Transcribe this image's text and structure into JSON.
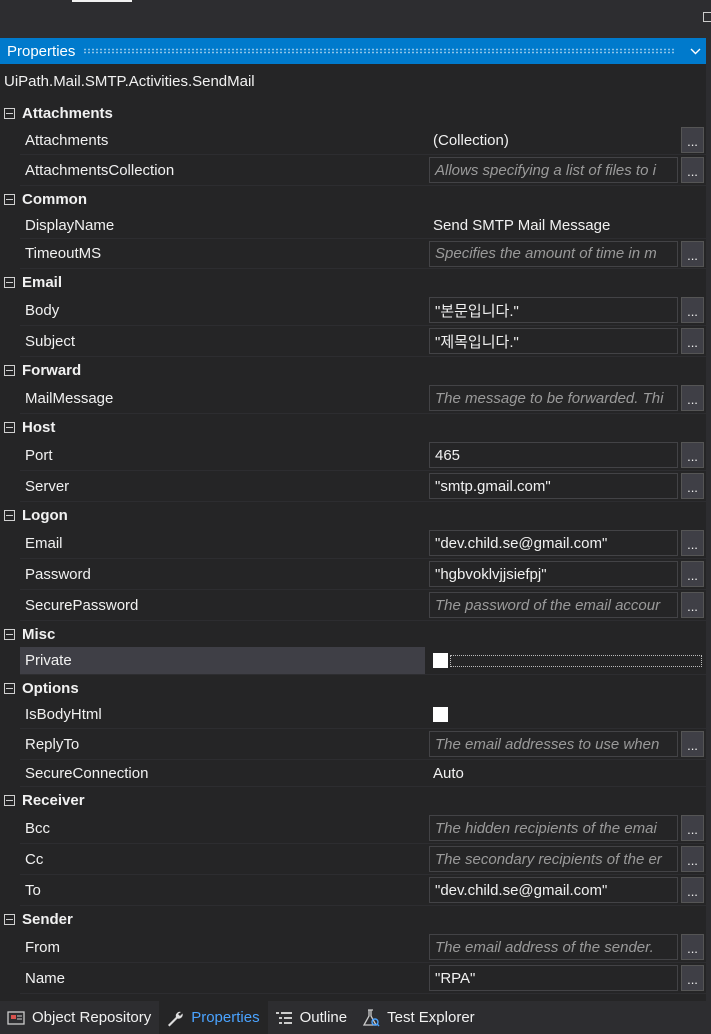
{
  "panel": {
    "title": "Properties",
    "type_name": "UiPath.Mail.SMTP.Activities.SendMail"
  },
  "categories": [
    {
      "name": "Attachments",
      "rows": [
        {
          "label": "Attachments",
          "value": "(Collection)",
          "kind": "plain",
          "ellipsis": true,
          "h": 29
        },
        {
          "label": "AttachmentsCollection",
          "value": "Allows specifying a list of files to i",
          "kind": "hint",
          "ellipsis": true,
          "h": 31
        }
      ]
    },
    {
      "name": "Common",
      "rows": [
        {
          "label": "DisplayName",
          "value": "Send SMTP Mail Message",
          "kind": "plain",
          "ellipsis": false,
          "h": 27
        },
        {
          "label": "TimeoutMS",
          "value": "Specifies the amount of time in m",
          "kind": "hint",
          "ellipsis": true,
          "h": 30
        }
      ]
    },
    {
      "name": "Email",
      "rows": [
        {
          "label": "Body",
          "value": "\"본문입니다.\"",
          "kind": "box",
          "ellipsis": true,
          "h": 31
        },
        {
          "label": "Subject",
          "value": "\"제목입니다.\"",
          "kind": "box",
          "ellipsis": true,
          "h": 31
        }
      ]
    },
    {
      "name": "Forward",
      "rows": [
        {
          "label": "MailMessage",
          "value": "The message to be forwarded. Thi",
          "kind": "hint",
          "ellipsis": true,
          "h": 31
        }
      ]
    },
    {
      "name": "Host",
      "rows": [
        {
          "label": "Port",
          "value": "465",
          "kind": "box",
          "ellipsis": true,
          "h": 31
        },
        {
          "label": "Server",
          "value": "\"smtp.gmail.com\"",
          "kind": "box",
          "ellipsis": true,
          "h": 31
        }
      ]
    },
    {
      "name": "Logon",
      "rows": [
        {
          "label": "Email",
          "value": "\"dev.child.se@gmail.com\"",
          "kind": "box",
          "ellipsis": true,
          "h": 31
        },
        {
          "label": "Password",
          "value": "\"hgbvoklvjjsiefpj\"",
          "kind": "box",
          "ellipsis": true,
          "h": 31
        },
        {
          "label": "SecurePassword",
          "value": "The password of the email accour",
          "kind": "hint",
          "ellipsis": true,
          "h": 31
        }
      ]
    },
    {
      "name": "Misc",
      "rows": [
        {
          "label": "Private",
          "value": "",
          "kind": "checkdots",
          "ellipsis": false,
          "h": 28,
          "selected": true
        }
      ]
    },
    {
      "name": "Options",
      "rows": [
        {
          "label": "IsBodyHtml",
          "value": "",
          "kind": "check",
          "ellipsis": false,
          "h": 28
        },
        {
          "label": "ReplyTo",
          "value": "The email addresses to use when",
          "kind": "hint",
          "ellipsis": true,
          "h": 31
        },
        {
          "label": "SecureConnection",
          "value": "Auto",
          "kind": "plain",
          "ellipsis": false,
          "h": 27
        }
      ]
    },
    {
      "name": "Receiver",
      "rows": [
        {
          "label": "Bcc",
          "value": "The hidden recipients of the emai",
          "kind": "hint",
          "ellipsis": true,
          "h": 31
        },
        {
          "label": "Cc",
          "value": "The secondary recipients of the er",
          "kind": "hint",
          "ellipsis": true,
          "h": 31
        },
        {
          "label": "To",
          "value": "\"dev.child.se@gmail.com\"",
          "kind": "box",
          "ellipsis": true,
          "h": 31
        }
      ]
    },
    {
      "name": "Sender",
      "rows": [
        {
          "label": "From",
          "value": "The email address of the sender.",
          "kind": "hint",
          "ellipsis": true,
          "h": 31
        },
        {
          "label": "Name",
          "value": "\"RPA\"",
          "kind": "box",
          "ellipsis": true,
          "h": 31
        }
      ]
    }
  ],
  "ellipsis_label": "...",
  "bottom_tabs": [
    {
      "label": "Object Repository",
      "icon": "object-repository-icon",
      "active": false
    },
    {
      "label": "Properties",
      "icon": "wrench-icon",
      "active": true
    },
    {
      "label": "Outline",
      "icon": "outline-icon",
      "active": false
    },
    {
      "label": "Test Explorer",
      "icon": "test-explorer-icon",
      "active": false
    }
  ]
}
